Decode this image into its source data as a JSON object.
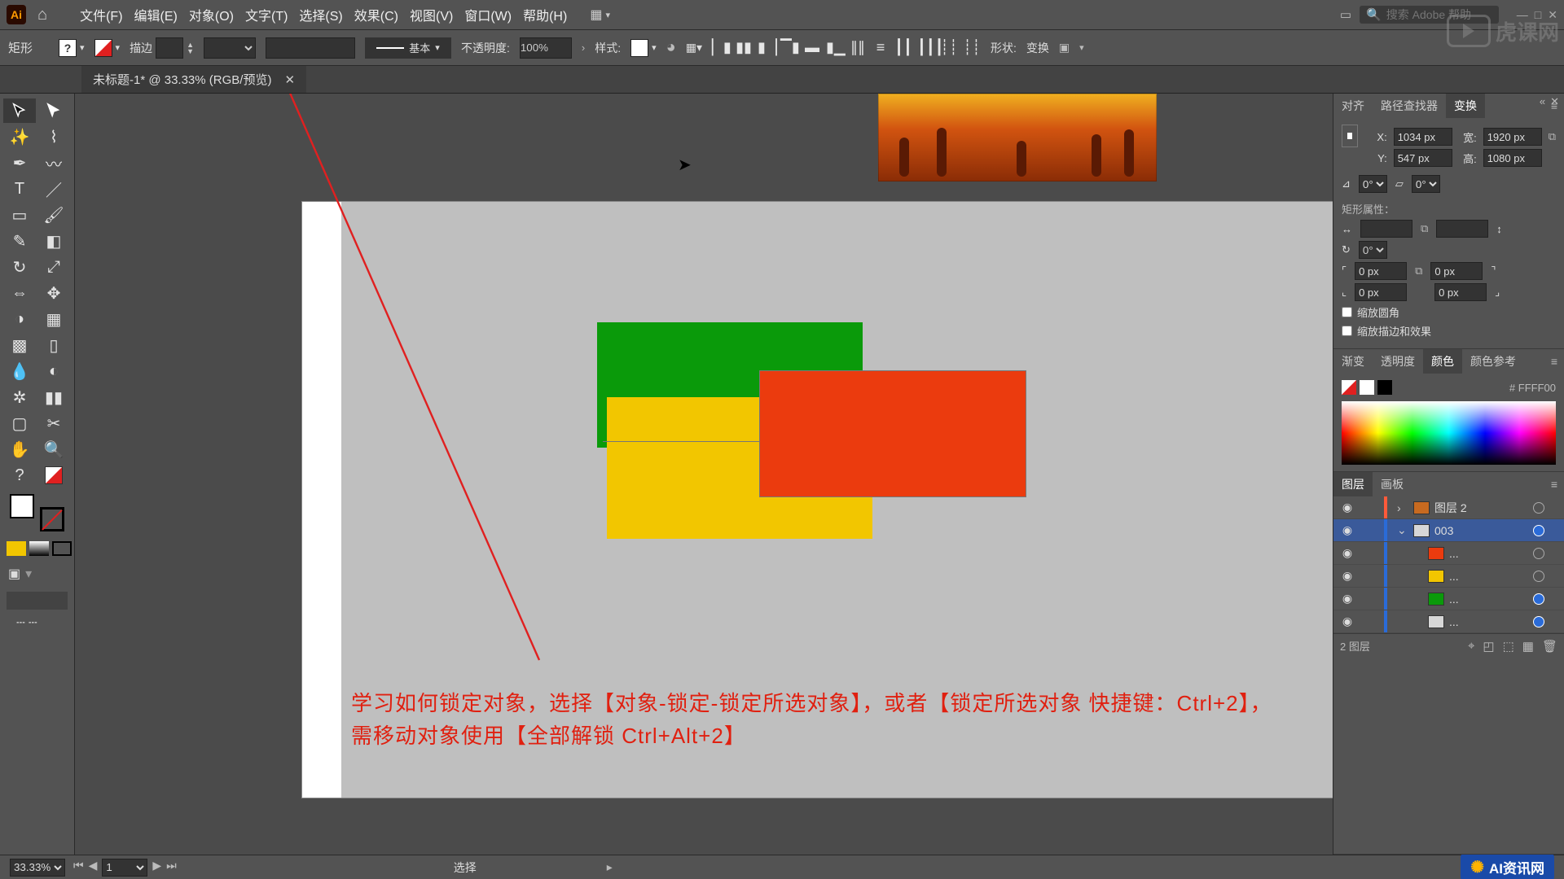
{
  "menubar": {
    "items": [
      "文件(F)",
      "编辑(E)",
      "对象(O)",
      "文字(T)",
      "选择(S)",
      "效果(C)",
      "视图(V)",
      "窗口(W)",
      "帮助(H)"
    ],
    "search_placeholder": "搜索 Adobe 帮助"
  },
  "optionsbar": {
    "shape_label": "矩形",
    "stroke_label": "描边",
    "brush_label": "基本",
    "opacity_label": "不透明度:",
    "opacity_value": "100%",
    "style_label": "样式:",
    "shape_menu": "形状:",
    "transform_menu": "变换"
  },
  "tab": {
    "title": "未标题-1* @ 33.33% (RGB/预览)"
  },
  "transform": {
    "tabs": [
      "对齐",
      "路径查找器",
      "变换"
    ],
    "x": "1034 px",
    "y": "547 px",
    "w": "1920 px",
    "h": "1080 px",
    "x_label": "X:",
    "y_label": "Y:",
    "w_label": "宽:",
    "h_label": "高:",
    "rotate": "0°",
    "shear": "0°",
    "section_label": "矩形属性：",
    "corner_w": "",
    "corner_h": "",
    "corner_angle": "0°",
    "corners_tl": "0 px",
    "corners_tr": "0 px",
    "corners_bl": "0 px",
    "corners_br": "0 px",
    "cb_scale_corners": "缩放圆角",
    "cb_scale_strokes": "缩放描边和效果"
  },
  "color": {
    "tabs": [
      "渐变",
      "透明度",
      "颜色",
      "颜色参考"
    ],
    "hex_label": "# FFFF00"
  },
  "layers": {
    "tabs": [
      "图层",
      "画板"
    ],
    "rows": [
      {
        "name": "图层 2",
        "thumb": "#c76a20",
        "indent": 0,
        "arrow": "›",
        "eye": "◉",
        "target": false,
        "strip": "#ff5a3a"
      },
      {
        "name": "003",
        "thumb": "#d7d7d7",
        "indent": 0,
        "arrow": "⌄",
        "eye": "◉",
        "target": true,
        "strip": "#2a6bd8",
        "sel": true
      },
      {
        "name": "...",
        "thumb": "#eb3b0e",
        "indent": 1,
        "arrow": "",
        "eye": "◉",
        "target": false,
        "strip": "#2a6bd8"
      },
      {
        "name": "...",
        "thumb": "#f2c600",
        "indent": 1,
        "arrow": "",
        "eye": "◉",
        "target": false,
        "strip": "#2a6bd8"
      },
      {
        "name": "...",
        "thumb": "#0a9a0a",
        "indent": 1,
        "arrow": "",
        "eye": "◉",
        "target": true,
        "strip": "#2a6bd8"
      },
      {
        "name": "...",
        "thumb": "#d7d7d7",
        "indent": 1,
        "arrow": "",
        "eye": "◉",
        "target": true,
        "strip": "#2a6bd8"
      }
    ],
    "footer_count": "2 图层"
  },
  "statusbar": {
    "zoom": "33.33%",
    "artboard": "1",
    "selection_label": "选择"
  },
  "canvas": {
    "note_line1": "学习如何锁定对象，选择【对象-锁定-锁定所选对象】，或者【锁定所选对象 快捷键：Ctrl+2】，",
    "note_line2": "需移动对象使用【全部解锁 Ctrl+Alt+2】"
  },
  "branding": {
    "watermark": "虎课网",
    "badge": "AI资讯网"
  }
}
